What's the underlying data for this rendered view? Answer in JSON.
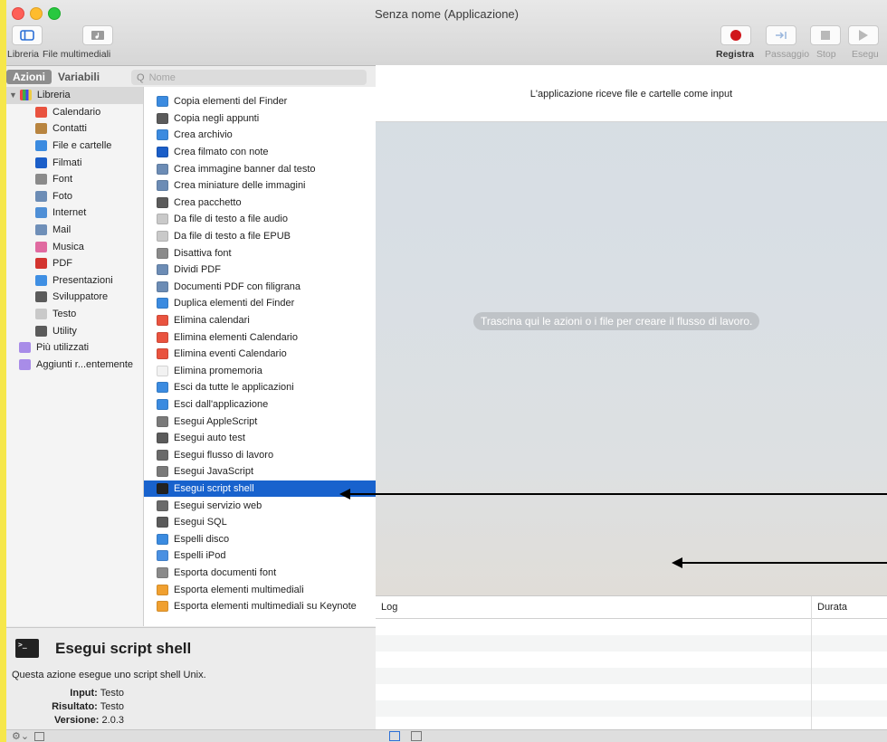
{
  "window": {
    "title": "Senza nome (Applicazione)"
  },
  "toolbar": {
    "left": [
      {
        "label": "Libreria",
        "icon": "sidebar-icon"
      },
      {
        "label": "File multimediali",
        "icon": "media-icon"
      }
    ],
    "right": [
      {
        "label": "Registra",
        "icon": "record-icon",
        "enabled": true
      },
      {
        "label": "Passaggio",
        "icon": "step-icon",
        "enabled": false
      },
      {
        "label": "Stop",
        "icon": "stop-icon",
        "enabled": false
      },
      {
        "label": "Esegu",
        "icon": "run-icon",
        "enabled": false
      }
    ]
  },
  "tabs": {
    "actions": "Azioni",
    "variables": "Variabili"
  },
  "search": {
    "placeholder": "Nome"
  },
  "library": {
    "root": "Libreria",
    "items": [
      {
        "label": "Calendario",
        "icon": "calendar-icon",
        "color": "#e9533f"
      },
      {
        "label": "Contatti",
        "icon": "contacts-icon",
        "color": "#b8843f"
      },
      {
        "label": "File e cartelle",
        "icon": "finder-icon",
        "color": "#3b8be0"
      },
      {
        "label": "Filmati",
        "icon": "quicktime-icon",
        "color": "#1b5ec8"
      },
      {
        "label": "Font",
        "icon": "font-icon",
        "color": "#8a8a8a"
      },
      {
        "label": "Foto",
        "icon": "photo-icon",
        "color": "#6c8cb5"
      },
      {
        "label": "Internet",
        "icon": "internet-icon",
        "color": "#4f8fd6"
      },
      {
        "label": "Mail",
        "icon": "mail-icon",
        "color": "#6f8fb8"
      },
      {
        "label": "Musica",
        "icon": "music-icon",
        "color": "#e06aa0"
      },
      {
        "label": "PDF",
        "icon": "pdf-icon",
        "color": "#d3342f"
      },
      {
        "label": "Presentazioni",
        "icon": "keynote-icon",
        "color": "#3f8fe3"
      },
      {
        "label": "Sviluppatore",
        "icon": "developer-icon",
        "color": "#5b5b5b"
      },
      {
        "label": "Testo",
        "icon": "text-icon",
        "color": "#c9c9c9"
      },
      {
        "label": "Utility",
        "icon": "utility-icon",
        "color": "#5b5b5b"
      }
    ],
    "smart": [
      {
        "label": "Più utilizzati",
        "icon": "smart-folder-icon",
        "color": "#a88ce8"
      },
      {
        "label": "Aggiunti r...entemente",
        "icon": "smart-folder-icon",
        "color": "#a88ce8"
      }
    ]
  },
  "actions": [
    {
      "label": "Copia elementi del Finder",
      "icon": "finder-icon",
      "color": "#3b8be0"
    },
    {
      "label": "Copia negli appunti",
      "icon": "utility-icon",
      "color": "#5b5b5b"
    },
    {
      "label": "Crea archivio",
      "icon": "finder-icon",
      "color": "#3b8be0"
    },
    {
      "label": "Crea filmato con note",
      "icon": "quicktime-icon",
      "color": "#1b5ec8"
    },
    {
      "label": "Crea immagine banner dal testo",
      "icon": "photo-icon",
      "color": "#6c8cb5"
    },
    {
      "label": "Crea miniature delle immagini",
      "icon": "photo-icon",
      "color": "#6c8cb5"
    },
    {
      "label": "Crea pacchetto",
      "icon": "developer-icon",
      "color": "#5b5b5b"
    },
    {
      "label": "Da file di testo a file audio",
      "icon": "text-icon",
      "color": "#c9c9c9"
    },
    {
      "label": "Da file di testo a file EPUB",
      "icon": "text-icon",
      "color": "#c9c9c9"
    },
    {
      "label": "Disattiva font",
      "icon": "font-icon",
      "color": "#8a8a8a"
    },
    {
      "label": "Dividi PDF",
      "icon": "photo-icon",
      "color": "#6c8cb5"
    },
    {
      "label": "Documenti PDF con filigrana",
      "icon": "photo-icon",
      "color": "#6c8cb5"
    },
    {
      "label": "Duplica elementi del Finder",
      "icon": "finder-icon",
      "color": "#3b8be0"
    },
    {
      "label": "Elimina calendari",
      "icon": "calendar-icon",
      "color": "#e9533f"
    },
    {
      "label": "Elimina elementi Calendario",
      "icon": "calendar-icon",
      "color": "#e9533f"
    },
    {
      "label": "Elimina eventi Calendario",
      "icon": "calendar-icon",
      "color": "#e9533f"
    },
    {
      "label": "Elimina promemoria",
      "icon": "reminders-icon",
      "color": "#f2f2f2"
    },
    {
      "label": "Esci da tutte le applicazioni",
      "icon": "finder-icon",
      "color": "#3b8be0"
    },
    {
      "label": "Esci dall'applicazione",
      "icon": "finder-icon",
      "color": "#3b8be0"
    },
    {
      "label": "Esegui AppleScript",
      "icon": "script-icon",
      "color": "#7a7a7a"
    },
    {
      "label": "Esegui auto test",
      "icon": "developer-icon",
      "color": "#5b5b5b"
    },
    {
      "label": "Esegui flusso di lavoro",
      "icon": "automator-icon",
      "color": "#6a6a6a"
    },
    {
      "label": "Esegui JavaScript",
      "icon": "script-icon",
      "color": "#7a7a7a"
    },
    {
      "label": "Esegui script shell",
      "icon": "terminal-icon",
      "color": "#222222",
      "selected": true
    },
    {
      "label": "Esegui servizio web",
      "icon": "automator-icon",
      "color": "#6a6a6a"
    },
    {
      "label": "Esegui SQL",
      "icon": "developer-icon",
      "color": "#5b5b5b"
    },
    {
      "label": "Espelli disco",
      "icon": "finder-icon",
      "color": "#3b8be0"
    },
    {
      "label": "Espelli iPod",
      "icon": "music-icon",
      "color": "#4a90e2"
    },
    {
      "label": "Esporta documenti font",
      "icon": "font-icon",
      "color": "#8a8a8a"
    },
    {
      "label": "Esporta elementi multimediali",
      "icon": "photos-icon",
      "color": "#f0a030"
    },
    {
      "label": "Esporta elementi multimediali su Keynote",
      "icon": "photos-icon",
      "color": "#f0a030"
    }
  ],
  "description": {
    "title": "Esegui script shell",
    "text": "Questa azione esegue uno script shell Unix.",
    "input_label": "Input:",
    "input_value": "Testo",
    "result_label": "Risultato:",
    "result_value": "Testo",
    "version_label": "Versione:",
    "version_value": "2.0.3"
  },
  "workflow": {
    "header": "L'applicazione riceve file e cartelle come input",
    "drop_hint": "Trascina qui le azioni o i file per creare il flusso di lavoro."
  },
  "log": {
    "col1": "Log",
    "col2": "Durata"
  }
}
